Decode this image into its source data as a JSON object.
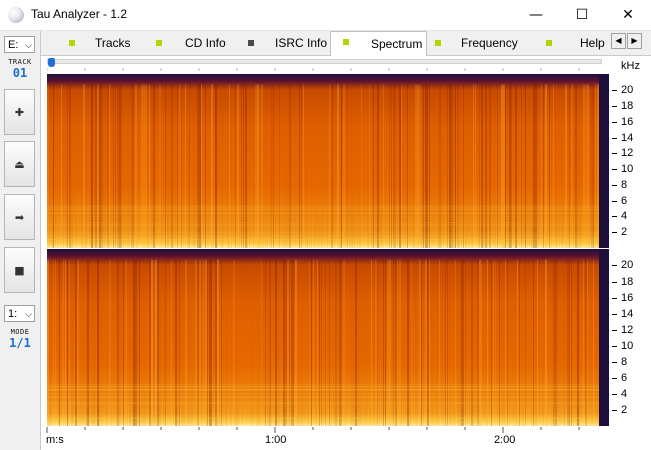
{
  "window": {
    "title": "Tau Analyzer - 1.2",
    "minimize_glyph": "—",
    "maximize_glyph": "☐",
    "close_glyph": "✕"
  },
  "left_panel": {
    "drive_value": "E:",
    "drive_caret": "⌵",
    "track_label": "TRACK",
    "track_number": "01",
    "buttons": [
      {
        "name": "add-icon",
        "glyph": "✚"
      },
      {
        "name": "eject-icon",
        "glyph": "⏏"
      },
      {
        "name": "play-icon",
        "glyph": "➡"
      },
      {
        "name": "stop-icon",
        "glyph": "■"
      }
    ],
    "mode_select_value": "1:",
    "mode_caret": "⌵",
    "mode_label": "MODE",
    "mode_value": "1/1"
  },
  "tabs": [
    {
      "label": "Tracks",
      "led_color": "#b5d400",
      "active": false
    },
    {
      "label": "CD Info",
      "led_color": "#b5d400",
      "active": false
    },
    {
      "label": "ISRC Info",
      "led_color": "#4a4a4a",
      "active": false
    },
    {
      "label": "Spectrum",
      "led_color": "#b5d400",
      "active": true
    },
    {
      "label": "Frequency",
      "led_color": "#b5d400",
      "active": false
    },
    {
      "label": "Help",
      "led_color": "#b5d400",
      "active": false
    }
  ],
  "tab_scroll": {
    "left": "◀",
    "right": "▶"
  },
  "spectrum": {
    "freq_unit": "kHz",
    "freq_ticks": [
      "20",
      "18",
      "16",
      "14",
      "12",
      "10",
      "8",
      "6",
      "4",
      "2"
    ],
    "time_unit_label": "m:s",
    "time_ticks": [
      "1:00",
      "2:00"
    ],
    "position_fraction": 0.0,
    "colors": {
      "background_dark": "#1d0f3a",
      "mid_orange": "#e86a00",
      "hot_yellow": "#ffd24a"
    }
  }
}
